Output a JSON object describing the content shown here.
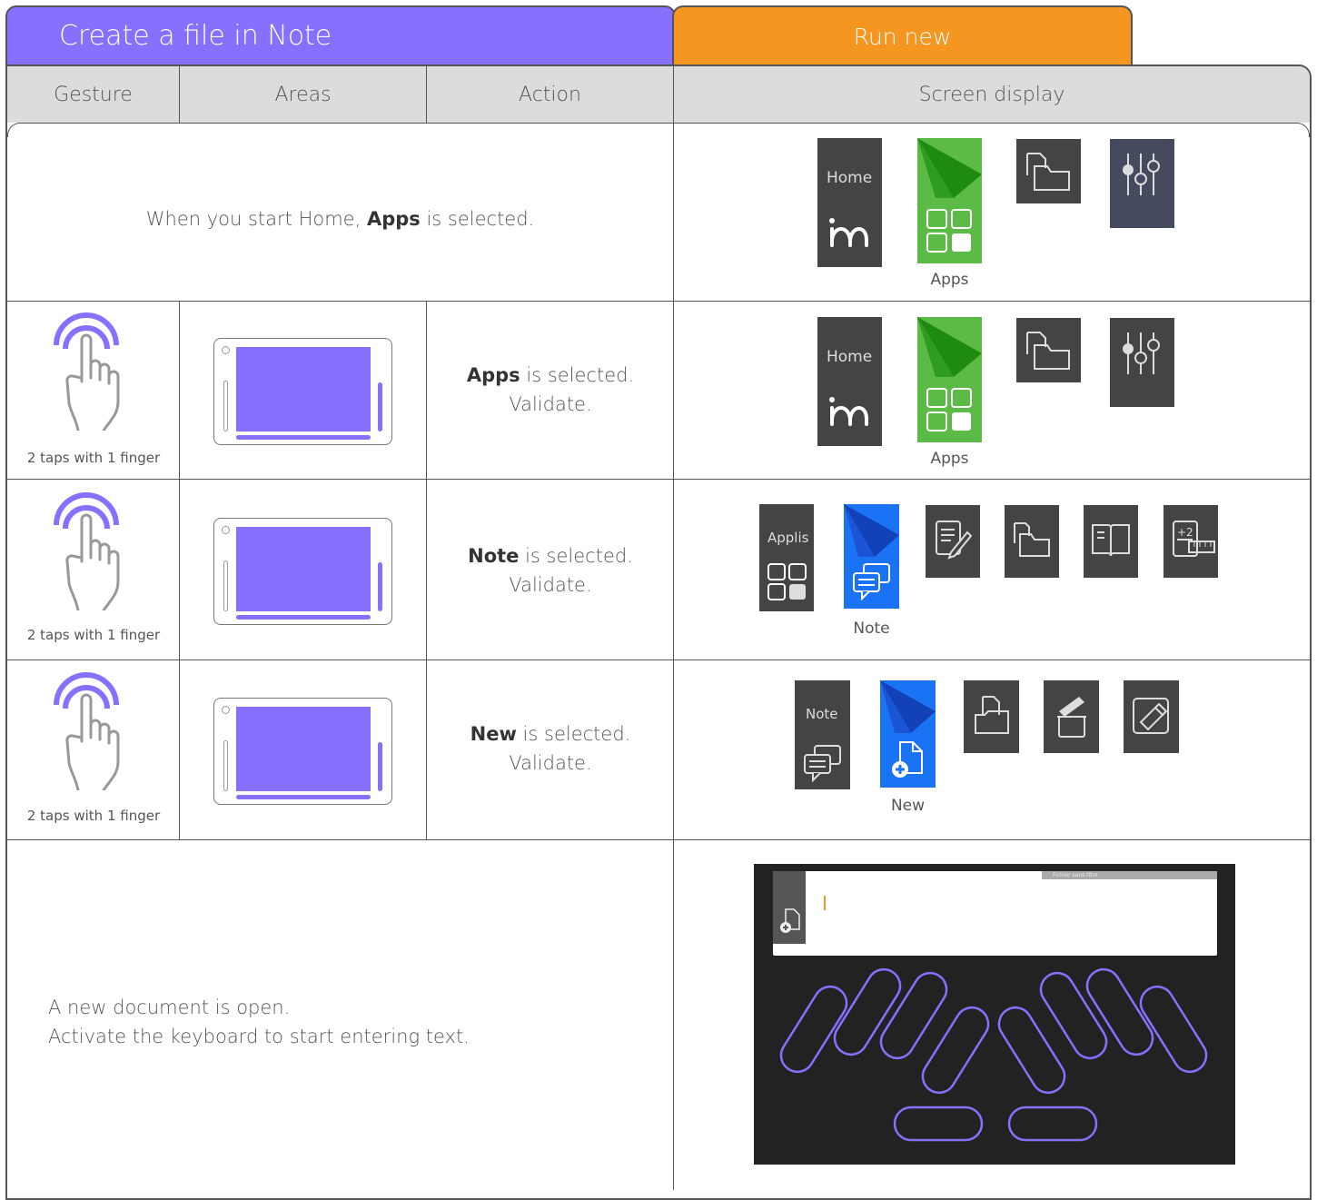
{
  "header": {
    "title": "Create a file in Note",
    "tab_run": "Run new"
  },
  "columns": {
    "gesture": "Gesture",
    "areas": "Areas",
    "action": "Action",
    "screen": "Screen display"
  },
  "row1": {
    "text_pre": "When you start Home, ",
    "text_bold": "Apps",
    "text_post": " is selected.",
    "tile_home": "Home",
    "label_selected": "Apps"
  },
  "row2": {
    "caption": "2 taps with 1 finger",
    "action_bold": "Apps",
    "action_rest": " is selected.",
    "action_line2": "Validate.",
    "tile_home": "Home",
    "label_selected": "Apps"
  },
  "row3": {
    "caption": "2 taps with 1 finger",
    "action_bold": "Note",
    "action_rest": " is selected.",
    "action_line2": "Validate.",
    "tile_parent": "Applis",
    "label_selected": "Note"
  },
  "row4": {
    "caption": "2 taps with 1 finger",
    "action_bold": "New",
    "action_rest": " is selected.",
    "action_line2": "Validate.",
    "tile_parent": "Note",
    "label_selected": "New"
  },
  "row5": {
    "line1": "A new document is open.",
    "line2": "Activate the keyboard to start entering text.",
    "doc_title": "Fichier sans titre"
  },
  "colors": {
    "purple": "#8770fe",
    "orange": "#f59621",
    "green": "#5bbb46",
    "blue": "#1a73f5",
    "tile_dark": "#444444",
    "tile_navy": "#454a5e"
  }
}
